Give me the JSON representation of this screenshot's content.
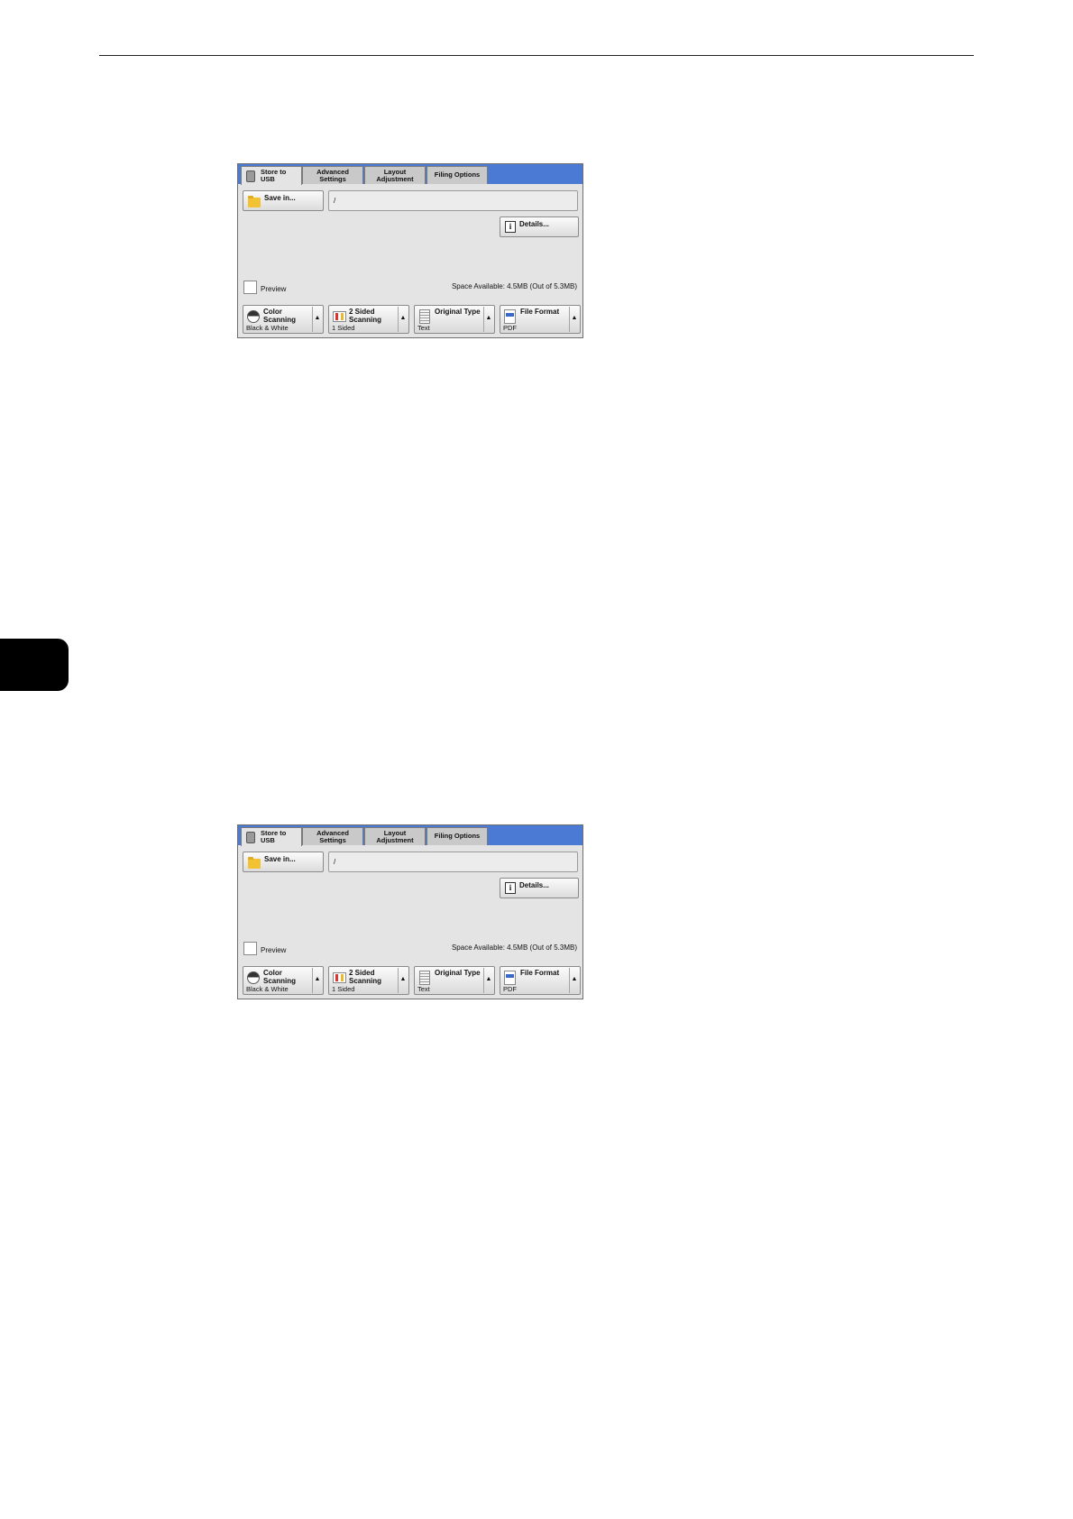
{
  "screens": [
    {
      "tabs": [
        {
          "label": "Store to\nUSB",
          "active": true
        },
        {
          "label": "Advanced\nSettings",
          "active": false
        },
        {
          "label": "Layout\nAdjustment",
          "active": false
        },
        {
          "label": "Filing Options",
          "active": false
        }
      ],
      "save_in_label": "Save in...",
      "path_value": "/",
      "details_label": "Details...",
      "preview_label": "Preview",
      "space_available": "Space Available: 4.5MB (Out of 5.3MB)",
      "features": [
        {
          "title": "Color\nScanning",
          "value": "Black & White",
          "icon": "color-scanning-icon"
        },
        {
          "title": "2 Sided\nScanning",
          "value": "1 Sided",
          "icon": "two-sided-icon"
        },
        {
          "title": "Original Type",
          "value": "Text",
          "icon": "document-icon"
        },
        {
          "title": "File Format",
          "value": "PDF",
          "icon": "pdf-icon"
        }
      ]
    },
    {
      "tabs": [
        {
          "label": "Store to\nUSB",
          "active": true
        },
        {
          "label": "Advanced\nSettings",
          "active": false
        },
        {
          "label": "Layout\nAdjustment",
          "active": false
        },
        {
          "label": "Filing Options",
          "active": false
        }
      ],
      "save_in_label": "Save in...",
      "path_value": "/",
      "details_label": "Details...",
      "preview_label": "Preview",
      "space_available": "Space Available: 4.5MB (Out of 5.3MB)",
      "features": [
        {
          "title": "Color\nScanning",
          "value": "Black & White",
          "icon": "color-scanning-icon"
        },
        {
          "title": "2 Sided\nScanning",
          "value": "1 Sided",
          "icon": "two-sided-icon"
        },
        {
          "title": "Original Type",
          "value": "Text",
          "icon": "document-icon"
        },
        {
          "title": "File Format",
          "value": "PDF",
          "icon": "pdf-icon"
        }
      ]
    }
  ],
  "colors": {
    "tabbar": "#4a7ad3",
    "panel": "#e4e4e4",
    "chapter_tab": "#000000"
  }
}
